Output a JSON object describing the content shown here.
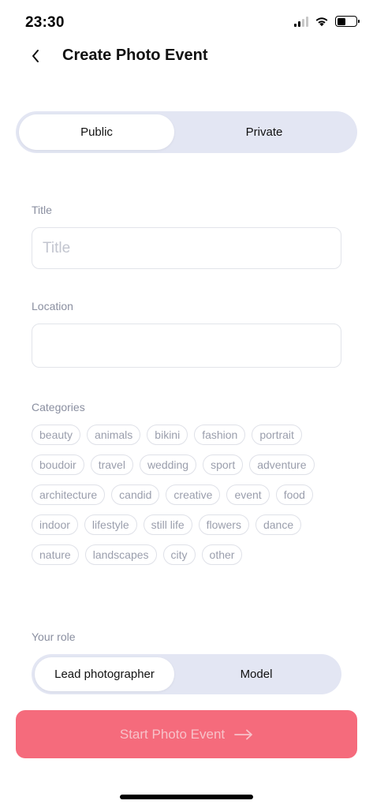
{
  "status_bar": {
    "time": "23:30",
    "signal_icon": "cellular-signal-icon",
    "wifi_icon": "wifi-icon",
    "battery_icon": "battery-icon",
    "battery_level": 0.45
  },
  "nav": {
    "back_icon": "chevron-left-icon",
    "title": "Create Photo Event"
  },
  "visibility": {
    "options": [
      "Public",
      "Private"
    ],
    "selected": "Public"
  },
  "form": {
    "title_label": "Title",
    "title_placeholder": "Title",
    "title_value": "",
    "location_label": "Location",
    "location_value": "",
    "categories_label": "Categories",
    "categories": [
      "beauty",
      "animals",
      "bikini",
      "fashion",
      "portrait",
      "boudoir",
      "travel",
      "wedding",
      "sport",
      "adventure",
      "architecture",
      "candid",
      "creative",
      "event",
      "food",
      "indoor",
      "lifestyle",
      "still life",
      "flowers",
      "dance",
      "nature",
      "landscapes",
      "city",
      "other"
    ],
    "role_label": "Your role",
    "role_options": [
      "Lead photographer",
      "Model"
    ],
    "role_selected": "Lead photographer"
  },
  "start_button": {
    "label": "Start Photo Event",
    "icon": "arrow-right-icon"
  },
  "colors": {
    "accent": "#f56b7c",
    "segment_bg": "#e3e6f3",
    "muted_text": "#8a8fa0"
  }
}
